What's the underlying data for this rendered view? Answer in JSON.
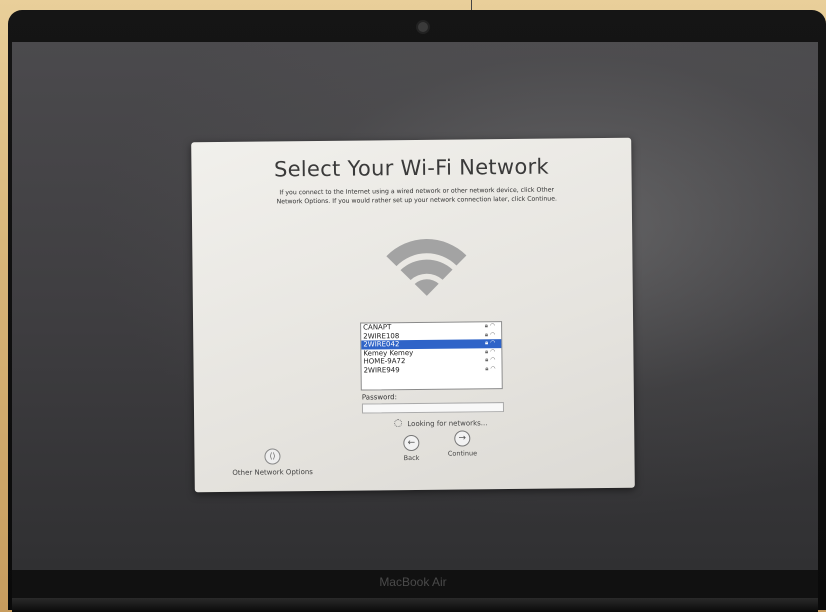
{
  "setup": {
    "title": "Select Your Wi-Fi Network",
    "subtitle_line1": "If you connect to the Internet using a wired network or other network device, click Other",
    "subtitle_line2": "Network Options. If you would rather set up your network connection later, click Continue.",
    "networks": [
      {
        "name": "CANAPT",
        "locked": true,
        "selected": false
      },
      {
        "name": "2WIRE108",
        "locked": true,
        "selected": false
      },
      {
        "name": "2WIRE042",
        "locked": true,
        "selected": true
      },
      {
        "name": "Kemey Kemey",
        "locked": true,
        "selected": false
      },
      {
        "name": "HOME-9A72",
        "locked": true,
        "selected": false
      },
      {
        "name": "2WIRE949",
        "locked": true,
        "selected": false
      }
    ],
    "password_label": "Password:",
    "status_text": "Looking for networks...",
    "back_label": "Back",
    "continue_label": "Continue",
    "other_options_label": "Other Network Options"
  },
  "device": {
    "brand_label": "MacBook Air"
  },
  "colors": {
    "selection": "#2f64c8",
    "dialog_bg": "#e9e7e2",
    "wifi_icon": "#9a9a9a"
  },
  "icons": {
    "wifi_large": "wifi-icon",
    "lock": "lock-icon",
    "signal": "wifi-signal-icon",
    "back": "left-arrow-icon",
    "continue": "right-arrow-icon",
    "other": "network-options-icon",
    "spinner": "spinner-icon"
  }
}
